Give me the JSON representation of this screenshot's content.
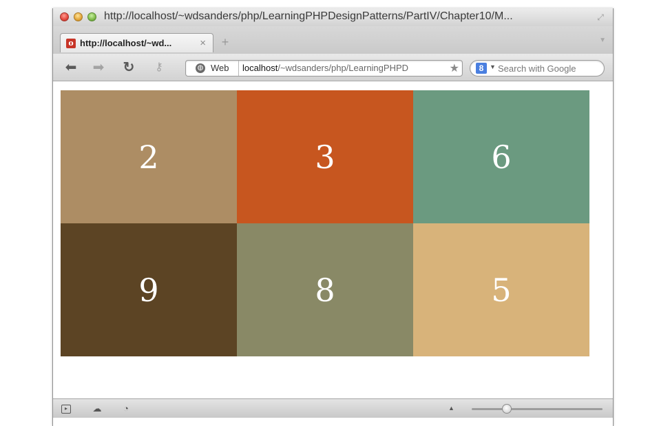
{
  "window": {
    "title": "http://localhost/~wdsanders/php/LearningPHPDesignPatterns/PartIV/Chapter10/M..."
  },
  "tab": {
    "title": "http://localhost/~wd...",
    "close": "×",
    "new_tab": "+"
  },
  "toolbar": {
    "scheme_label": "Web",
    "url_host": "localhost",
    "url_path": "/~wdsanders/php/LearningPHPD",
    "search_placeholder": "Search with Google",
    "search_engine_glyph": "8"
  },
  "grid": {
    "cells": [
      {
        "number": "2",
        "color": "#ad8d64"
      },
      {
        "number": "3",
        "color": "#c7561f"
      },
      {
        "number": "6",
        "color": "#6b9a80"
      },
      {
        "number": "9",
        "color": "#5c4424"
      },
      {
        "number": "8",
        "color": "#898966"
      },
      {
        "number": "5",
        "color": "#d8b37a"
      }
    ]
  },
  "statusbar": {
    "icons": [
      "panel-icon",
      "cloud-icon",
      "speedometer-icon"
    ]
  }
}
